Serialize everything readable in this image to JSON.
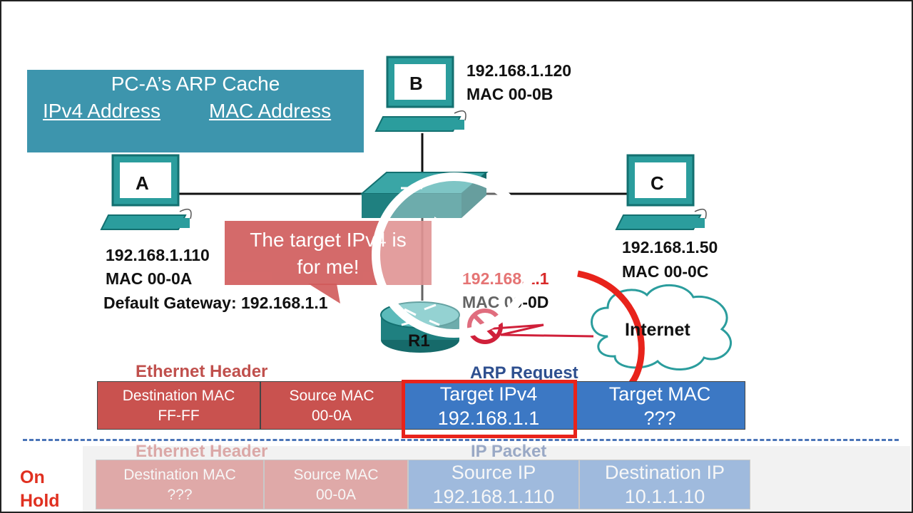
{
  "arp_cache": {
    "title": "PC-A’s ARP Cache",
    "col_ipv4": "IPv4 Address",
    "col_mac": "MAC Address"
  },
  "hosts": {
    "a": {
      "label": "A",
      "ip": "192.168.1.110",
      "mac": "MAC 00-0A",
      "gateway": "Default Gateway: 192.168.1.1"
    },
    "b": {
      "label": "B",
      "ip": "192.168.1.120",
      "mac": "MAC 00-0B"
    },
    "c": {
      "label": "C",
      "ip": "192.168.1.50",
      "mac": "MAC 00-0C"
    },
    "r1": {
      "label": "R1",
      "ip": "192.168.1.1",
      "mac": "MAC 00-0D"
    }
  },
  "callout": {
    "line1": "The target IPv4 is",
    "line2": "for me!"
  },
  "cloud": {
    "label": "Internet"
  },
  "frame": {
    "ethernet_label": "Ethernet Header",
    "arp_label": "ARP Request",
    "cells": [
      {
        "title": "Destination MAC",
        "value": "FF-FF"
      },
      {
        "title": "Source MAC",
        "value": "00-0A"
      },
      {
        "title": "Target IPv4",
        "value": "192.168.1.1"
      },
      {
        "title": "Target MAC",
        "value": "???"
      }
    ]
  },
  "held_packet": {
    "status": [
      "On",
      "Hold"
    ],
    "ethernet_label": "Ethernet Header",
    "ip_label": "IP Packet",
    "cells": [
      {
        "title": "Destination MAC",
        "value": "???"
      },
      {
        "title": "Source MAC",
        "value": "00-0A"
      },
      {
        "title": "Source IP",
        "value": "192.168.1.110"
      },
      {
        "title": "Destination IP",
        "value": "10.1.1.10"
      }
    ]
  },
  "colors": {
    "cache": "#3d95ad",
    "pc": "#1f8c8c",
    "red_cells": "#c9524f",
    "blue_cells": "#3c78c4",
    "highlight": "#e8231b"
  },
  "icons": [
    "pc-icon",
    "switch-icon",
    "router-icon",
    "cloud-icon",
    "play-icon"
  ]
}
